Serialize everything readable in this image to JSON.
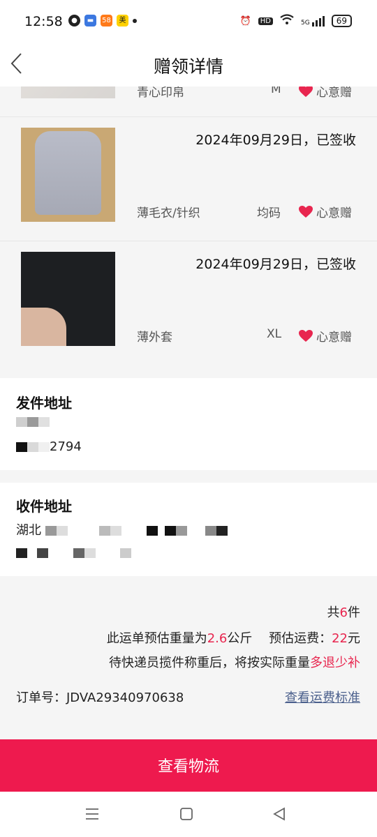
{
  "status": {
    "time": "12:58",
    "hd": "HD",
    "network": "5G",
    "battery": "69"
  },
  "header": {
    "title": "赠领详情"
  },
  "items": [
    {
      "date": "",
      "category": "青心印帛",
      "size": "M",
      "tag": "心意赠"
    },
    {
      "date": "2024年09月29日，已签收",
      "category": "薄毛衣/针织",
      "size": "均码",
      "tag": "心意赠"
    },
    {
      "date": "2024年09月29日，已签收",
      "category": "薄外套",
      "size": "XL",
      "tag": "心意赠"
    }
  ],
  "sender": {
    "title": "发件地址",
    "phone_tail": "2794"
  },
  "receiver": {
    "title": "收件地址",
    "line_prefix": "湖北"
  },
  "summary": {
    "count_prefix": "共",
    "count": "6",
    "count_suffix": "件",
    "weight_prefix": "此运单预估重量为",
    "weight": "2.6",
    "weight_unit": "公斤",
    "fee_label": "预估运费：",
    "fee": "22",
    "fee_unit": "元",
    "note_prefix": "待快递员揽件称重后，将按实际重量",
    "note_highlight": "多退少补",
    "order_label": "订单号：",
    "order_no": "JDVA29340970638",
    "fee_standard_link": "查看运费标准"
  },
  "cta": {
    "label": "查看物流"
  },
  "colors": {
    "accent": "#ee1a4e",
    "highlight": "#e8264f",
    "link": "#4a5f8c"
  }
}
